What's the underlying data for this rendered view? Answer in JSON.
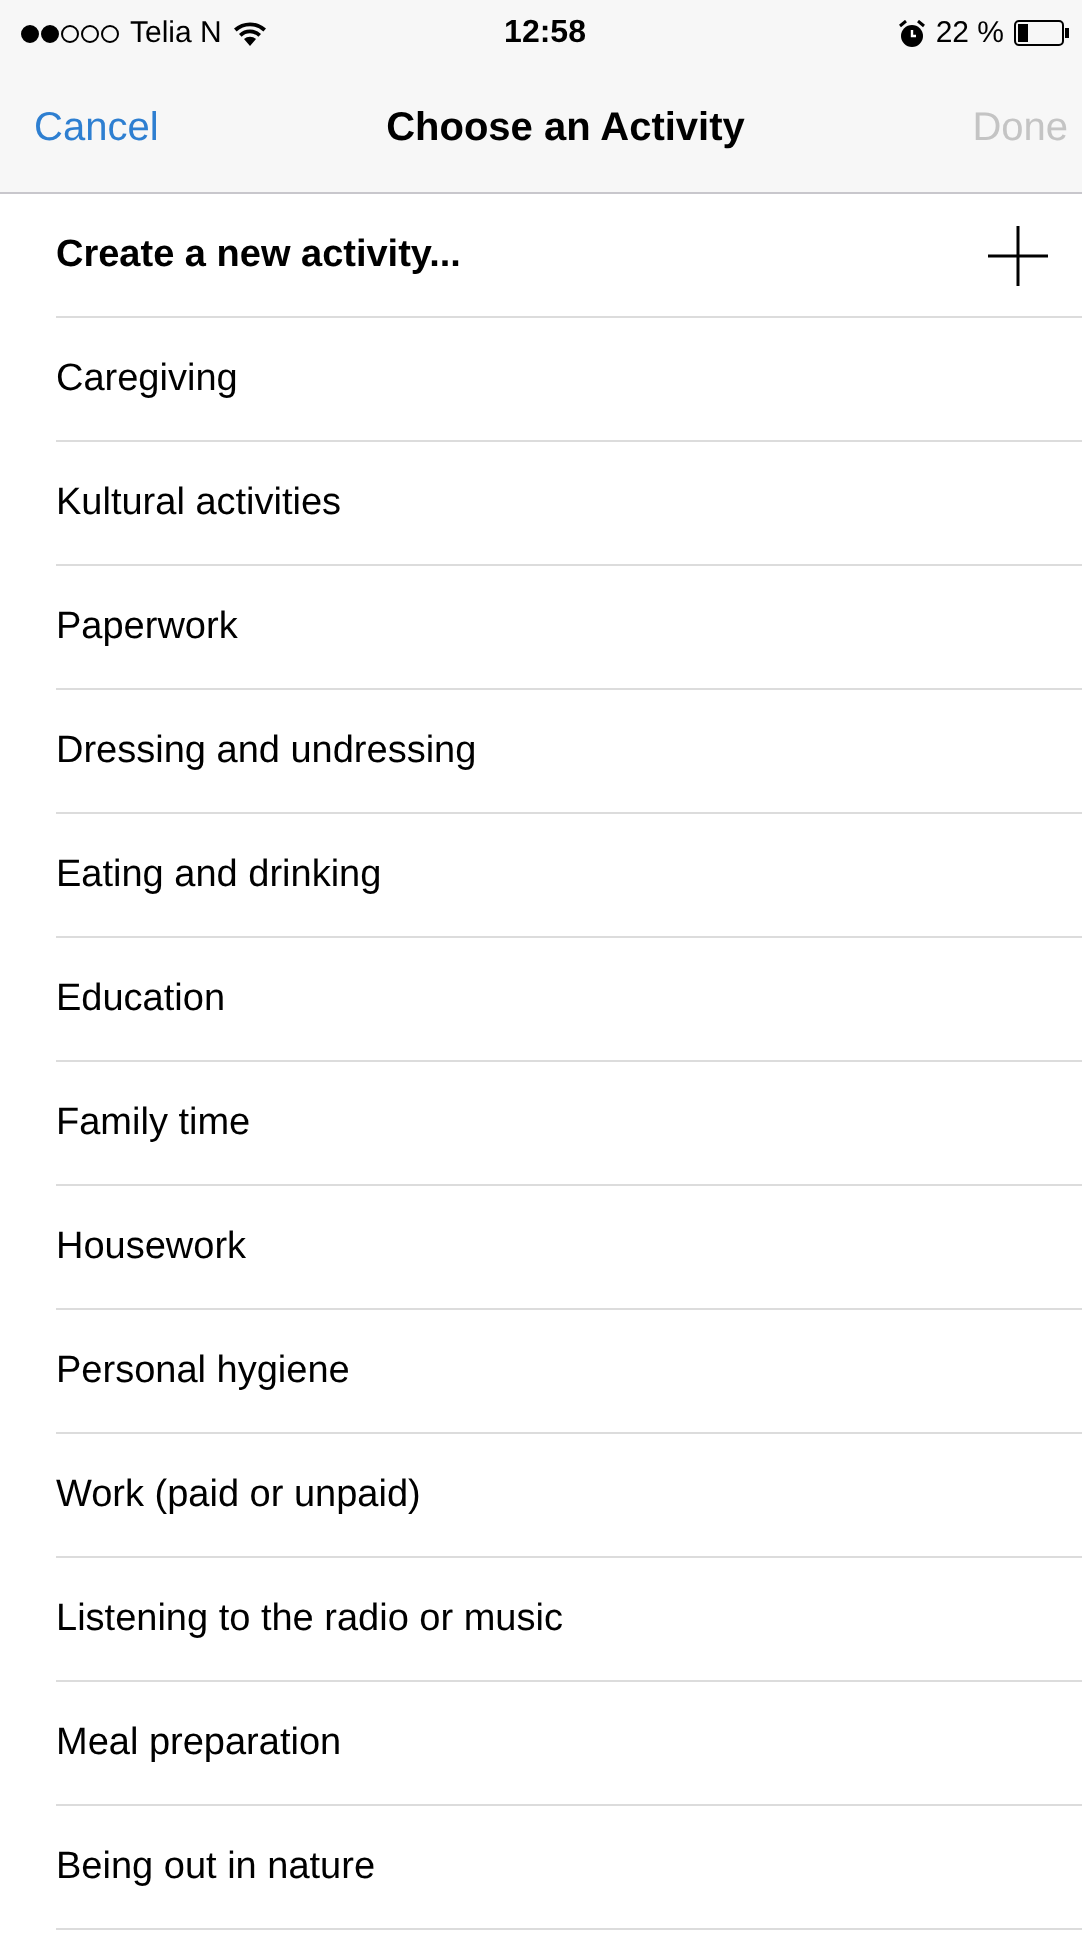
{
  "status_bar": {
    "carrier": "Telia N",
    "time": "12:58",
    "battery": "22 %"
  },
  "nav_bar": {
    "cancel": "Cancel",
    "title": "Choose an Activity",
    "done": {
      "label": "Done",
      "disabled": true
    }
  },
  "create_row": {
    "label": "Create a new activity..."
  },
  "activities": [
    {
      "label": "Caregiving"
    },
    {
      "label": "Kultural activities"
    },
    {
      "label": "Paperwork"
    },
    {
      "label": "Dressing and undressing"
    },
    {
      "label": "Eating and drinking"
    },
    {
      "label": "Education"
    },
    {
      "label": "Family time"
    },
    {
      "label": "Housework"
    },
    {
      "label": "Personal hygiene"
    },
    {
      "label": "Work (paid or unpaid)"
    },
    {
      "label": "Listening to the radio or music"
    },
    {
      "label": "Meal preparation"
    },
    {
      "label": "Being out in nature"
    }
  ]
}
